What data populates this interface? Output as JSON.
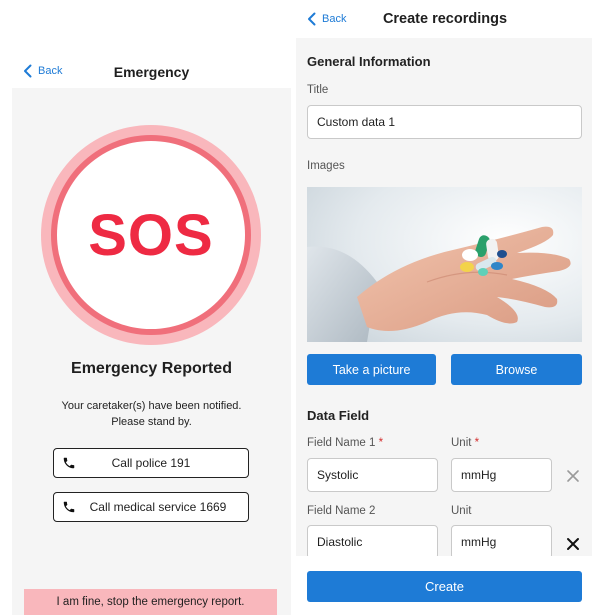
{
  "emergency": {
    "back_label": "Back",
    "title": "Emergency",
    "sos_text": "SOS",
    "reported_heading": "Emergency Reported",
    "notify_line1": "Your caretaker(s) have been notified.",
    "notify_line2": "Please stand by.",
    "call_police_label": "Call police 191",
    "call_medical_label": "Call medical service 1669",
    "fine_label": "I am fine, stop the emergency report.",
    "colors": {
      "sos_red": "#ee2a43",
      "ring": "#f06f7b",
      "halo": "#f9b7bc"
    }
  },
  "create": {
    "back_label": "Back",
    "title": "Create recordings",
    "general_heading": "General Information",
    "title_label": "Title",
    "title_value": "Custom data 1",
    "images_label": "Images",
    "take_picture_label": "Take a picture",
    "browse_label": "Browse",
    "data_field_heading": "Data Field",
    "fields": [
      {
        "name_label": "Field Name 1",
        "name_required": "*",
        "unit_label": "Unit",
        "unit_required": "*",
        "name_value": "Systolic",
        "unit_value": "mmHg"
      },
      {
        "name_label": "Field Name 2",
        "name_required": "",
        "unit_label": "Unit",
        "unit_required": "",
        "name_value": "Diastolic",
        "unit_value": "mmHg"
      }
    ],
    "create_label": "Create",
    "colors": {
      "primary": "#1e7bd6",
      "required": "#d32f2f"
    }
  }
}
